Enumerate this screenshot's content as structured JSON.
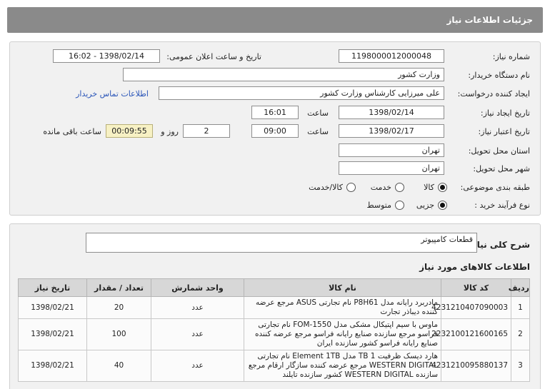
{
  "header": {
    "title": "جزئیات اطلاعات نیاز"
  },
  "form": {
    "need_number": {
      "label": "شماره نیاز:",
      "value": "1198000012000048"
    },
    "announce": {
      "label": "تاریخ و ساعت اعلان عمومی:",
      "value": "1398/02/14 - 16:02"
    },
    "buyer": {
      "label": "نام دستگاه خریدار:",
      "value": "وزارت کشور"
    },
    "creator": {
      "label": "ایجاد کننده درخواست:",
      "value": "علی میرزایی کارشناس وزارت کشور",
      "contact_link": "اطلاعات تماس خریدار"
    },
    "created": {
      "label": "تاریخ ایجاد نیاز:",
      "date": "1398/02/14",
      "time_label": "ساعت",
      "time": "16:01"
    },
    "validity": {
      "label": "تاریخ اعتبار نیاز:",
      "date": "1398/02/17",
      "time_label": "ساعت",
      "time": "09:00",
      "days": "2",
      "days_label": "روز و",
      "remaining": "00:09:55",
      "remaining_label": "ساعت باقی مانده"
    },
    "province": {
      "label": "استان محل تحویل:",
      "value": "تهران"
    },
    "city": {
      "label": "شهر محل تحویل:",
      "value": "تهران"
    },
    "category": {
      "label": "طبقه بندی موضوعی:",
      "options": [
        "کالا",
        "خدمت",
        "کالا/خدمت"
      ],
      "selected": "کالا"
    },
    "process": {
      "label": "نوع فرآیند خرید :",
      "options": [
        "جزیی",
        "متوسط"
      ],
      "selected": "جزیی"
    }
  },
  "general": {
    "label": "شرح کلی نیاز:",
    "value": "قطعات کامپیوتر"
  },
  "goods": {
    "title": "اطلاعات کالاهای مورد نیاز",
    "columns": [
      "ردیف",
      "کد کالا",
      "نام کالا",
      "واحد شمارش",
      "تعداد / مقدار",
      "تاریخ نیاز"
    ],
    "rows": [
      {
        "idx": "1",
        "code": "4231210407090003",
        "name": "مادربرد رایانه مدل P8H61 نام تجارتی ASUS مرجع عرضه کننده دیباذر تجارت",
        "unit": "عدد",
        "qty": "20",
        "date": "1398/02/21"
      },
      {
        "idx": "2",
        "code": "2232100121600165",
        "name": "ماوس با سیم اپتیکال مشکی مدل FOM-1550 نام تجارتی فراسو مرجع سازنده صنایع رایانه فراسو مرجع عرضه کننده صنایع رایانه فراسو کشور سازنده ایران",
        "unit": "عدد",
        "qty": "100",
        "date": "1398/02/21"
      },
      {
        "idx": "3",
        "code": "4231210095880137",
        "name": "هارد دیسک ظرفیت 1 TB مدل Element 1TB نام تجارتی WESTERN DIGITAL مرجع عرضه کننده سازگار ارقام مرجع سازنده WESTERN DIGITAL کشور سازنده تایلند",
        "unit": "عدد",
        "qty": "40",
        "date": "1398/02/21"
      }
    ]
  }
}
